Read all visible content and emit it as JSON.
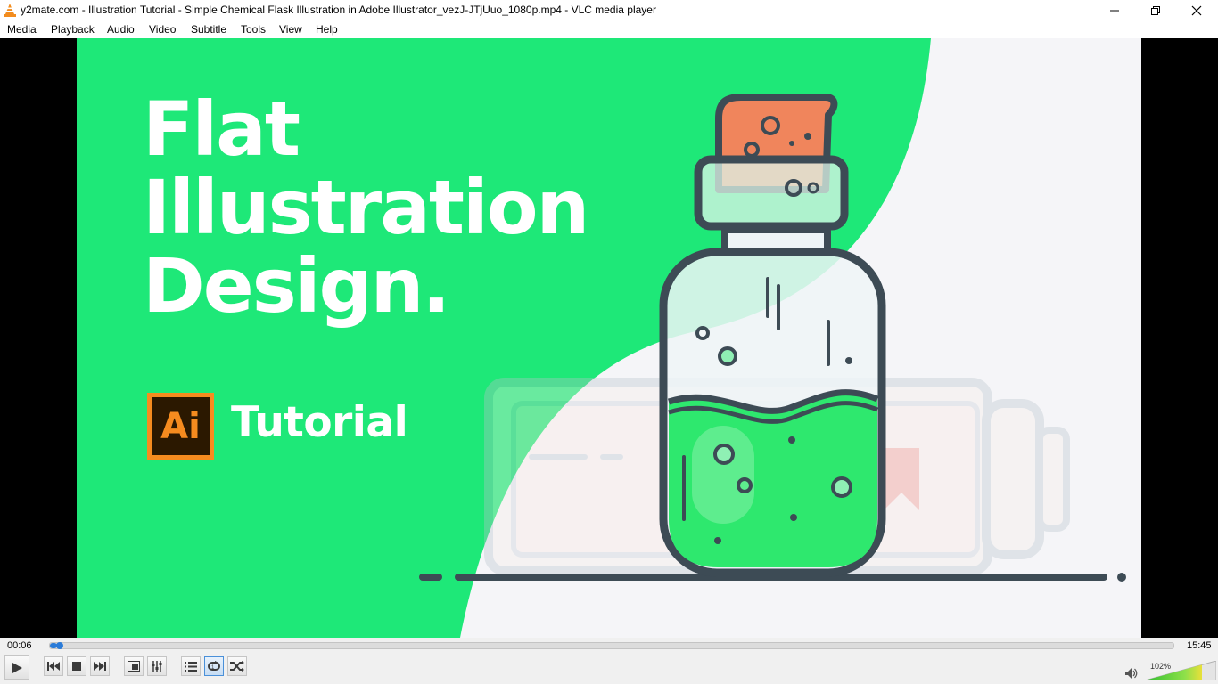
{
  "window": {
    "title": "y2mate.com - Illustration Tutorial - Simple Chemical Flask Illustration in Adobe Illustrator_vezJ-JTjUuo_1080p.mp4 - VLC media player"
  },
  "menu": [
    "Media",
    "Playback",
    "Audio",
    "Video",
    "Subtitle",
    "Tools",
    "View",
    "Help"
  ],
  "video": {
    "headline": [
      "Flat",
      "Illustration",
      "Design."
    ],
    "badge": "Ai",
    "tagline": "Tutorial",
    "colors": {
      "green": "#1ee878",
      "dark": "#3d4b55",
      "cork": "#f0855c",
      "liquid": "#2ee86e"
    }
  },
  "playback": {
    "current_time": "00:06",
    "total_time": "15:45",
    "progress_fraction": 0.0063,
    "volume_label": "102%",
    "volume_fraction": 0.8
  },
  "icons": {
    "play": "play-icon",
    "prev": "previous-icon",
    "stop": "stop-icon",
    "next": "next-icon",
    "fullscreen": "fullscreen-icon",
    "extended": "extended-settings-icon",
    "playlist": "playlist-icon",
    "loop": "loop-icon",
    "random": "shuffle-icon",
    "volume": "speaker-icon"
  }
}
